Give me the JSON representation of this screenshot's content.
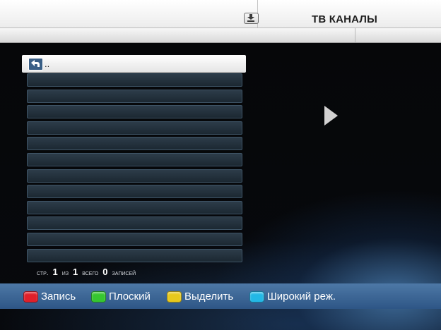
{
  "header": {
    "title": "ТВ КАНАЛЫ",
    "icon": "download-icon"
  },
  "list": {
    "up_item_label": "..",
    "rows": [
      "",
      "",
      "",
      "",
      "",
      "",
      "",
      "",
      "",
      "",
      "",
      ""
    ]
  },
  "status": {
    "page_prefix": "стр.",
    "page_current": "1",
    "page_of": "из",
    "page_total": "1",
    "total_label": "всего",
    "record_count": "0",
    "records_label": "записей"
  },
  "color_keys": [
    {
      "label": "Запись",
      "color": "#e0202a"
    },
    {
      "label": "Плоский",
      "color": "#36c630"
    },
    {
      "label": "Выделить",
      "color": "#e7c81c"
    },
    {
      "label": "Широкий реж.",
      "color": "#23b8e6"
    }
  ],
  "colors": {
    "header_bg": "#f2f2f2",
    "list_row_bg": "#24313c",
    "bottom_bar_bg": "#3b6596"
  }
}
